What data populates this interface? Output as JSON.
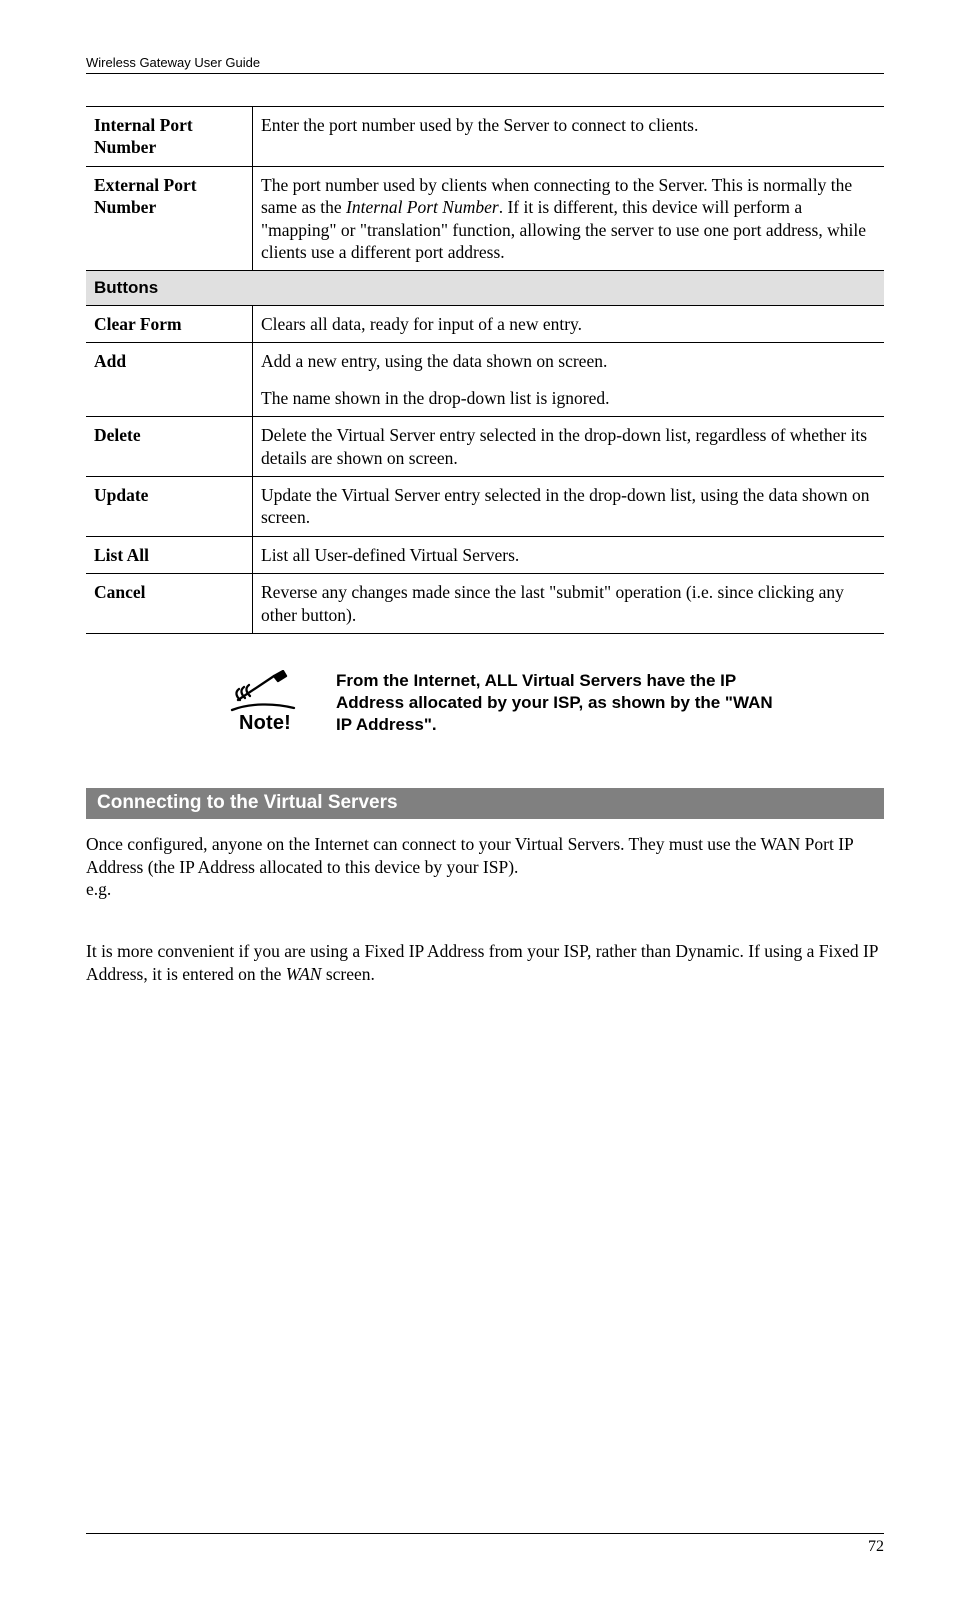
{
  "header": {
    "title": "Wireless Gateway User Guide"
  },
  "table": {
    "rows": [
      {
        "label": "Internal Port Number",
        "text": "Enter the port number used by the Server to connect to clients."
      },
      {
        "label": "External Port Number",
        "text_pre": "The port number used by clients when connecting to the Server. This is normally the same as the ",
        "text_italic": "Internal Port Number",
        "text_post": ". If it is different, this device will perform a \"mapping\" or \"translation\" function, allowing the server to use one port address, while clients use a different port address."
      }
    ],
    "buttons_header": "Buttons",
    "buttons": [
      {
        "label": "Clear Form",
        "text": "Clears all data, ready for input of a new entry."
      },
      {
        "label": "Add",
        "text": "Add a new entry, using the data shown on screen.",
        "text2": "The name shown in the drop-down list is ignored."
      },
      {
        "label": "Delete",
        "text": "Delete the Virtual Server entry selected in the drop-down list, regardless of whether its details are shown on screen."
      },
      {
        "label": "Update",
        "text": "Update the Virtual Server entry selected in the drop-down list, using the data shown on screen."
      },
      {
        "label": "List All",
        "text": "List all User-defined Virtual Servers."
      },
      {
        "label": "Cancel",
        "text": "Reverse any changes made since the last \"submit\" operation (i.e. since clicking any other button)."
      }
    ]
  },
  "note": {
    "label": "Note!",
    "text": "From the Internet, ALL Virtual Servers have the IP Address allocated by your ISP, as shown by the \"WAN IP Address\"."
  },
  "section": {
    "heading": "Connecting to the Virtual Servers",
    "para1": "Once configured, anyone on the Internet can connect to your Virtual Servers. They must use the WAN Port IP Address (the IP Address allocated to this device by your ISP).",
    "para1b": "e.g.",
    "para2_pre": "It is more convenient if you are using a Fixed IP Address from your ISP, rather than Dynamic. If using a Fixed IP Address, it is entered on the ",
    "para2_italic": "WAN",
    "para2_post": " screen."
  },
  "footer": {
    "page_number": "72"
  }
}
